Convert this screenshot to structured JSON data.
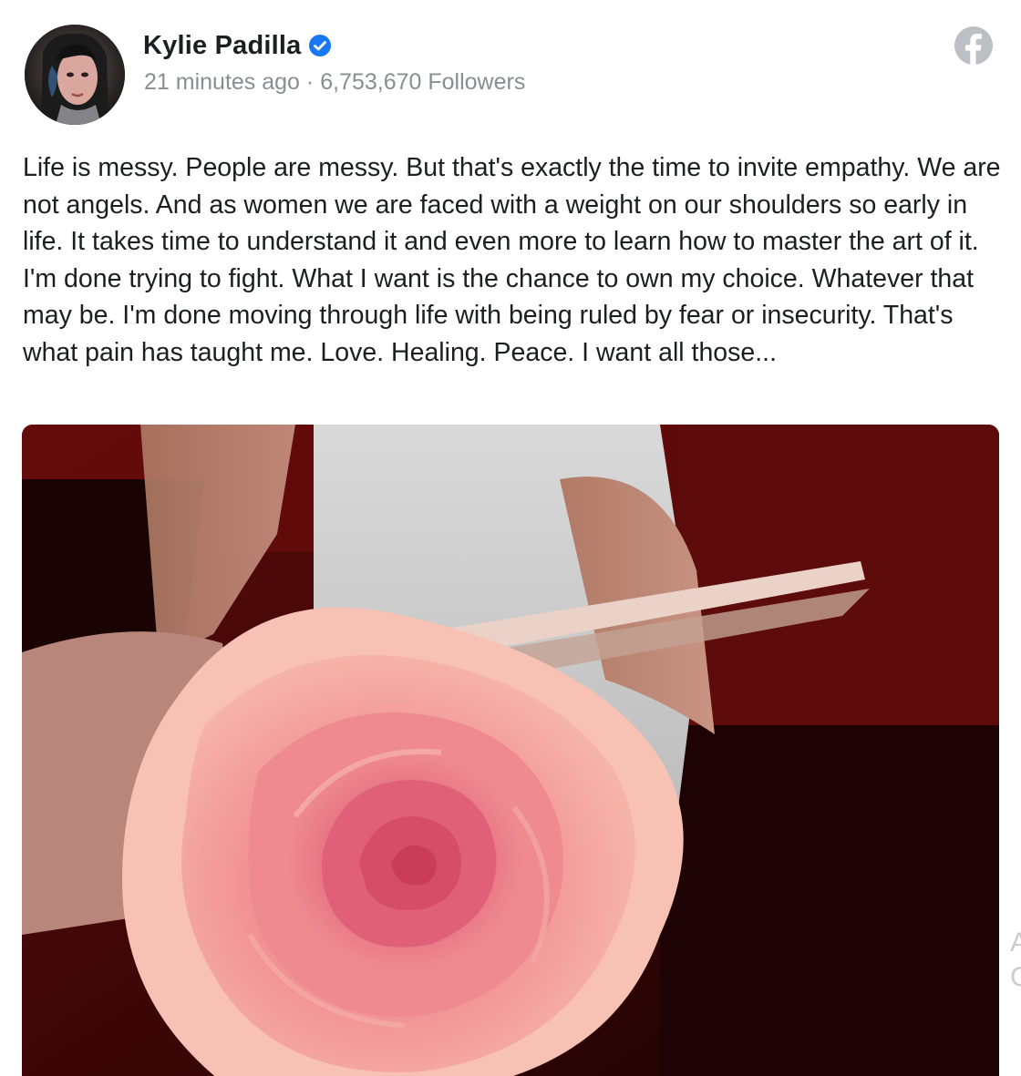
{
  "post": {
    "author_name": "Kylie Padilla",
    "verified_icon": "verified-badge-icon",
    "time_ago": "21 minutes ago",
    "separator": "·",
    "followers": "6,753,670 Followers",
    "source_icon": "facebook-icon",
    "text": "Life is messy. People are messy. But that's exactly the time to invite empathy. We are not angels. And as women we are faced with a weight on our shoulders so early in life. It takes time to understand it and even more to learn how to master the art of it. I'm done trying to fight. What I want is the chance to own my choice. Whatever that may be. I'm done moving through life with being ruled by fear or insecurity. That's what pain has taught me. Love. Healing. Peace. I want all those...",
    "photo_subject": "pink rose held in hand"
  },
  "edge": {
    "glyph_top": "A",
    "glyph_bottom": "C"
  },
  "colors": {
    "verified_blue": "#1877f2",
    "facebook_gray": "#bcc0c4",
    "text_dark": "#1c1e21",
    "text_muted": "#8a8d91"
  }
}
